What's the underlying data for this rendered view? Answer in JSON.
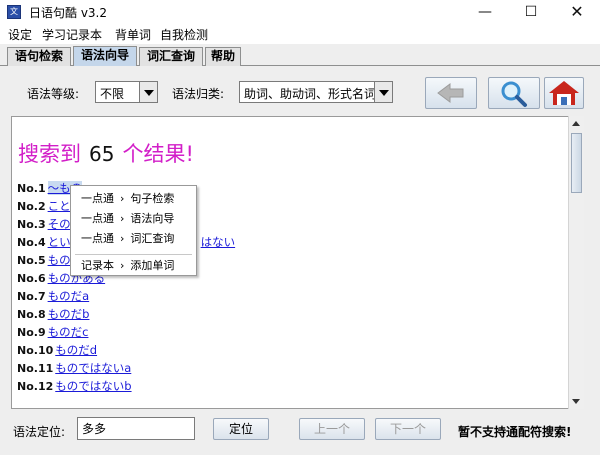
{
  "window": {
    "title": "日语句酷 v3.2",
    "icon_glyph": "文",
    "controls": [
      "—",
      "☐",
      "✕"
    ]
  },
  "menu": [
    "设定",
    "学习记录本",
    "背单词",
    "自我检测"
  ],
  "tabs": [
    {
      "label": "语句检索",
      "active": false
    },
    {
      "label": "语法向导",
      "active": true
    },
    {
      "label": "词汇查询",
      "active": false
    },
    {
      "label": "帮助",
      "active": false
    }
  ],
  "filters": {
    "level_label": "语法等级:",
    "level_value": "不限",
    "category_label": "语法归类:",
    "category_value": "助词、助动词、形式名词"
  },
  "toolbar": {
    "back_icon": "left-arrow-icon",
    "search_icon": "magnifier-icon",
    "home_icon": "home-icon"
  },
  "results": {
    "summary_pre": "搜索到",
    "count": "65",
    "summary_post": "个结果!",
    "items": [
      {
        "no": "No.1",
        "text": "～もの"
      },
      {
        "no": "No.2",
        "text": "こと"
      },
      {
        "no": "No.3",
        "text": "その"
      },
      {
        "no": "No.4",
        "text": "とい",
        "suffix": "はない"
      },
      {
        "no": "No.5",
        "text": "もの"
      },
      {
        "no": "No.6",
        "text": "ものがある"
      },
      {
        "no": "No.7",
        "text": "ものだa"
      },
      {
        "no": "No.8",
        "text": "ものだb"
      },
      {
        "no": "No.9",
        "text": "ものだc"
      },
      {
        "no": "No.10",
        "text": "ものだd"
      },
      {
        "no": "No.11",
        "text": "ものではないa"
      },
      {
        "no": "No.12",
        "text": "ものではないb"
      }
    ]
  },
  "context_menu": [
    {
      "group": "一点通",
      "target": "句子检索"
    },
    {
      "group": "一点通",
      "target": "语法向导"
    },
    {
      "group": "一点通",
      "target": "词汇查询"
    },
    {
      "group": "记录本",
      "target": "添加单词"
    }
  ],
  "bottom": {
    "locate_label": "语法定位:",
    "locate_value": "多多",
    "locate_button": "定位",
    "prev_button": "上一个",
    "next_button": "下一个",
    "note": "暂不支持通配符搜索!"
  },
  "colors": {
    "summary": "#d21ec8",
    "link": "#1b1bd8",
    "active_tab": "#c4d6ea",
    "home_roof": "#c8261d"
  }
}
